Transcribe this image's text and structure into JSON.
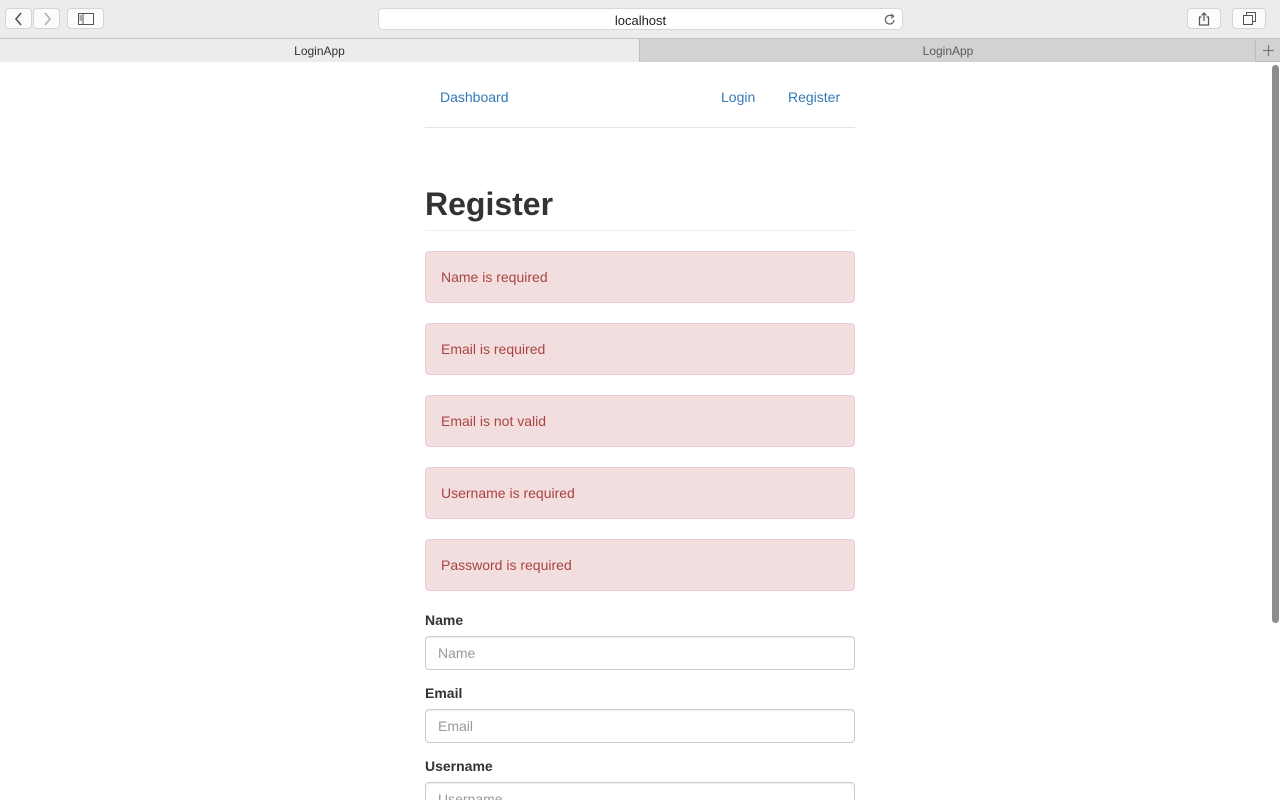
{
  "browser": {
    "url": "localhost",
    "tabs": [
      {
        "label": "LoginApp",
        "active": true
      },
      {
        "label": "LoginApp",
        "active": false
      }
    ]
  },
  "nav": {
    "brand": "Dashboard",
    "links": [
      {
        "label": "Login"
      },
      {
        "label": "Register"
      }
    ]
  },
  "page": {
    "title": "Register"
  },
  "alerts": [
    {
      "text": "Name is required"
    },
    {
      "text": "Email is required"
    },
    {
      "text": "Email is not valid"
    },
    {
      "text": "Username is required"
    },
    {
      "text": "Password is required"
    }
  ],
  "form": {
    "fields": [
      {
        "label": "Name",
        "placeholder": "Name",
        "value": ""
      },
      {
        "label": "Email",
        "placeholder": "Email",
        "value": ""
      },
      {
        "label": "Username",
        "placeholder": "Username",
        "value": ""
      }
    ]
  },
  "colors": {
    "link": "#337ab7",
    "alert_bg": "#f2dede",
    "alert_border": "#ebccd1",
    "alert_text": "#a94442"
  }
}
